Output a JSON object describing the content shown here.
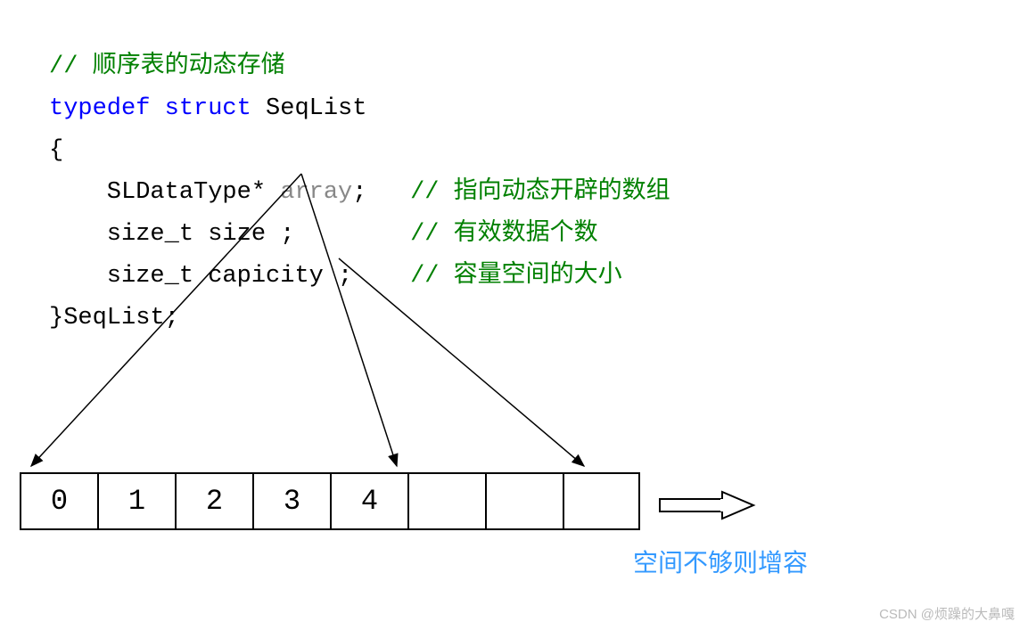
{
  "code": {
    "comment_top": "// 顺序表的动态存储",
    "typedef": "typedef",
    "struct": "struct",
    "struct_name": " SeqList",
    "brace_open": "{",
    "line_array_prefix": "    SLDataType* ",
    "line_array_var": "array",
    "line_array_semi": ";",
    "comment_array": "// 指向动态开辟的数组",
    "line_size": "    size_t size ;",
    "comment_size": "// 有效数据个数",
    "line_cap": "    size_t capicity ;",
    "comment_cap": "// 容量空间的大小",
    "brace_close": "}",
    "struct_alias": "SeqList",
    "end_semi": ";"
  },
  "array_cells": [
    "0",
    "1",
    "2",
    "3",
    "4",
    "",
    "",
    ""
  ],
  "caption": "空间不够则增容",
  "watermark": "CSDN @烦躁的大鼻嘎",
  "chart_data": {
    "type": "diagram",
    "title": "顺序表的动态存储",
    "struct_definition": {
      "name": "SeqList",
      "fields": [
        {
          "type": "SLDataType*",
          "name": "array",
          "comment": "指向动态开辟的数组"
        },
        {
          "type": "size_t",
          "name": "size",
          "comment": "有效数据个数"
        },
        {
          "type": "size_t",
          "name": "capicity",
          "comment": "容量空间的大小"
        }
      ]
    },
    "array_visual": {
      "filled": [
        0,
        1,
        2,
        3,
        4
      ],
      "capacity": 8,
      "note": "空间不够则增容"
    }
  }
}
